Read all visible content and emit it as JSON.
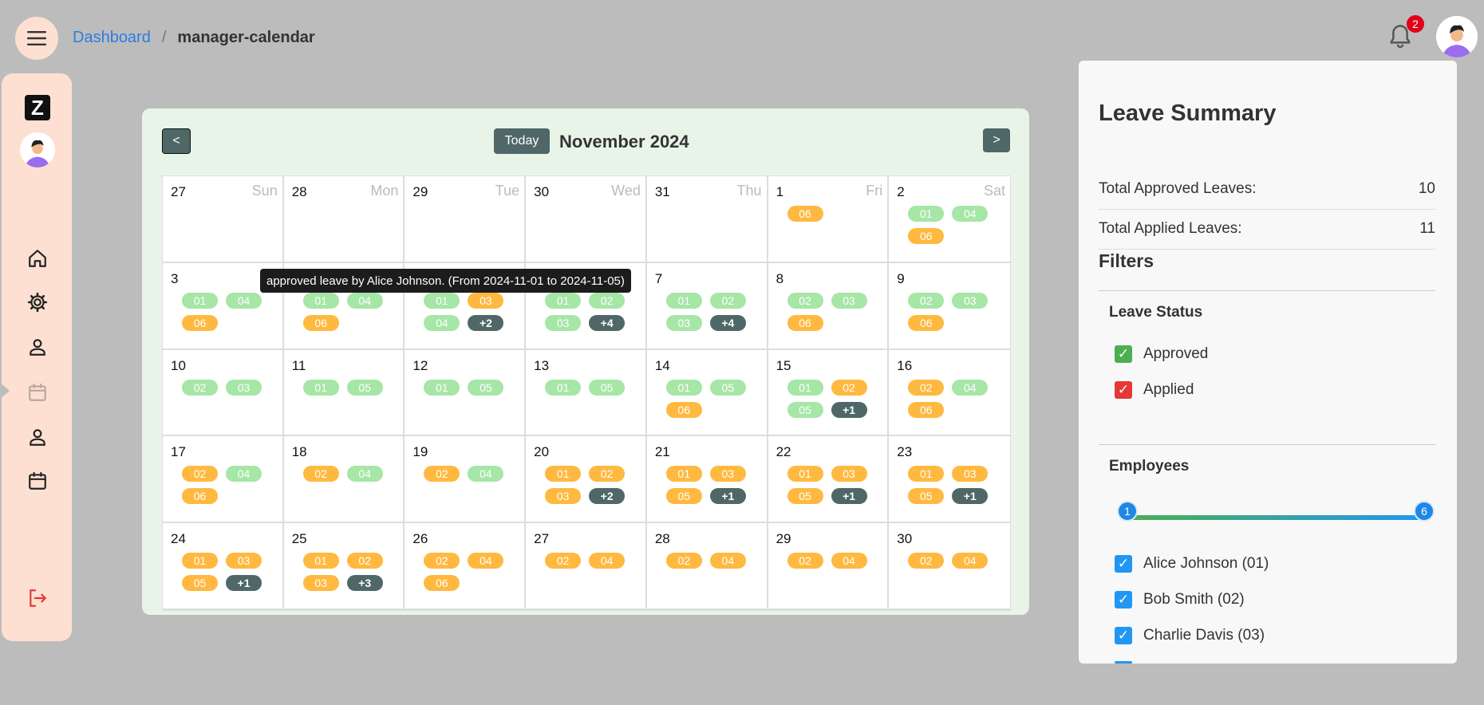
{
  "colors": {
    "approved": "#a6e6a6",
    "applied": "#ffb940",
    "more": "#4f6867",
    "approved_box": "#4caf50",
    "applied_box": "#e53935",
    "employee_box": "#2196f3"
  },
  "header": {
    "menu_icon": "hamburger-icon",
    "breadcrumb": {
      "root": "Dashboard",
      "separator": "/",
      "current": "manager-calendar"
    },
    "notifications": {
      "icon": "bell-icon",
      "count": "2"
    },
    "avatar_icon": "user-avatar"
  },
  "sidebar": {
    "logo": "Z",
    "items": [
      {
        "icon": "home-icon"
      },
      {
        "icon": "gear-icon"
      },
      {
        "icon": "person-icon"
      },
      {
        "icon": "calendar-icon",
        "active": true
      },
      {
        "icon": "person-icon"
      },
      {
        "icon": "calendar-icon"
      }
    ],
    "logout_icon": "logout-icon"
  },
  "calendar": {
    "prev_label": "<",
    "next_label": ">",
    "today_label": "Today",
    "month": "November 2024",
    "tooltip": "approved leave by Alice Johnson. (From 2024-11-01 to 2024-11-05)",
    "weeks": [
      [
        {
          "d": "27",
          "name": "Sun",
          "chips": []
        },
        {
          "d": "28",
          "name": "Mon",
          "chips": []
        },
        {
          "d": "29",
          "name": "Tue",
          "chips": []
        },
        {
          "d": "30",
          "name": "Wed",
          "chips": []
        },
        {
          "d": "31",
          "name": "Thu",
          "chips": []
        },
        {
          "d": "1",
          "name": "Fri",
          "chips": [
            [
              "06",
              "applied"
            ]
          ]
        },
        {
          "d": "2",
          "name": "Sat",
          "chips": [
            [
              "01",
              "approved"
            ],
            [
              "04",
              "approved"
            ],
            [
              "06",
              "applied"
            ]
          ]
        }
      ],
      [
        {
          "d": "3",
          "chips": [
            [
              "01",
              "approved"
            ],
            [
              "04",
              "approved"
            ],
            [
              "06",
              "applied"
            ]
          ]
        },
        {
          "d": "4",
          "chips": [
            [
              "01",
              "approved"
            ],
            [
              "04",
              "approved"
            ],
            [
              "06",
              "applied"
            ]
          ]
        },
        {
          "d": "5",
          "chips": [
            [
              "01",
              "approved"
            ],
            [
              "03",
              "applied"
            ],
            [
              "04",
              "approved"
            ],
            [
              "+2",
              "more"
            ]
          ]
        },
        {
          "d": "6",
          "chips": [
            [
              "01",
              "approved"
            ],
            [
              "02",
              "approved"
            ],
            [
              "03",
              "approved"
            ],
            [
              "+4",
              "more"
            ]
          ]
        },
        {
          "d": "7",
          "chips": [
            [
              "01",
              "approved"
            ],
            [
              "02",
              "approved"
            ],
            [
              "03",
              "approved"
            ],
            [
              "+4",
              "more"
            ]
          ]
        },
        {
          "d": "8",
          "chips": [
            [
              "02",
              "approved"
            ],
            [
              "03",
              "approved"
            ],
            [
              "06",
              "applied"
            ]
          ]
        },
        {
          "d": "9",
          "chips": [
            [
              "02",
              "approved"
            ],
            [
              "03",
              "approved"
            ],
            [
              "06",
              "applied"
            ]
          ]
        }
      ],
      [
        {
          "d": "10",
          "chips": [
            [
              "02",
              "approved"
            ],
            [
              "03",
              "approved"
            ]
          ]
        },
        {
          "d": "11",
          "chips": [
            [
              "01",
              "approved"
            ],
            [
              "05",
              "approved"
            ]
          ]
        },
        {
          "d": "12",
          "chips": [
            [
              "01",
              "approved"
            ],
            [
              "05",
              "approved"
            ]
          ]
        },
        {
          "d": "13",
          "chips": [
            [
              "01",
              "approved"
            ],
            [
              "05",
              "approved"
            ]
          ]
        },
        {
          "d": "14",
          "chips": [
            [
              "01",
              "approved"
            ],
            [
              "05",
              "approved"
            ],
            [
              "06",
              "applied"
            ]
          ]
        },
        {
          "d": "15",
          "chips": [
            [
              "01",
              "approved"
            ],
            [
              "02",
              "applied"
            ],
            [
              "05",
              "approved"
            ],
            [
              "+1",
              "more"
            ]
          ]
        },
        {
          "d": "16",
          "chips": [
            [
              "02",
              "applied"
            ],
            [
              "04",
              "approved"
            ],
            [
              "06",
              "applied"
            ]
          ]
        }
      ],
      [
        {
          "d": "17",
          "chips": [
            [
              "02",
              "applied"
            ],
            [
              "04",
              "approved"
            ],
            [
              "06",
              "applied"
            ]
          ]
        },
        {
          "d": "18",
          "chips": [
            [
              "02",
              "applied"
            ],
            [
              "04",
              "approved"
            ]
          ]
        },
        {
          "d": "19",
          "chips": [
            [
              "02",
              "applied"
            ],
            [
              "04",
              "approved"
            ]
          ]
        },
        {
          "d": "20",
          "chips": [
            [
              "01",
              "applied"
            ],
            [
              "02",
              "applied"
            ],
            [
              "03",
              "applied"
            ],
            [
              "+2",
              "more"
            ]
          ]
        },
        {
          "d": "21",
          "chips": [
            [
              "01",
              "applied"
            ],
            [
              "03",
              "applied"
            ],
            [
              "05",
              "applied"
            ],
            [
              "+1",
              "more"
            ]
          ]
        },
        {
          "d": "22",
          "chips": [
            [
              "01",
              "applied"
            ],
            [
              "03",
              "applied"
            ],
            [
              "05",
              "applied"
            ],
            [
              "+1",
              "more"
            ]
          ]
        },
        {
          "d": "23",
          "chips": [
            [
              "01",
              "applied"
            ],
            [
              "03",
              "applied"
            ],
            [
              "05",
              "applied"
            ],
            [
              "+1",
              "more"
            ]
          ]
        }
      ],
      [
        {
          "d": "24",
          "chips": [
            [
              "01",
              "applied"
            ],
            [
              "03",
              "applied"
            ],
            [
              "05",
              "applied"
            ],
            [
              "+1",
              "more"
            ]
          ]
        },
        {
          "d": "25",
          "chips": [
            [
              "01",
              "applied"
            ],
            [
              "02",
              "applied"
            ],
            [
              "03",
              "applied"
            ],
            [
              "+3",
              "more"
            ]
          ]
        },
        {
          "d": "26",
          "chips": [
            [
              "02",
              "applied"
            ],
            [
              "04",
              "applied"
            ],
            [
              "06",
              "applied"
            ]
          ]
        },
        {
          "d": "27",
          "chips": [
            [
              "02",
              "applied"
            ],
            [
              "04",
              "applied"
            ]
          ]
        },
        {
          "d": "28",
          "chips": [
            [
              "02",
              "applied"
            ],
            [
              "04",
              "applied"
            ]
          ]
        },
        {
          "d": "29",
          "chips": [
            [
              "02",
              "applied"
            ],
            [
              "04",
              "applied"
            ]
          ]
        },
        {
          "d": "30",
          "chips": [
            [
              "02",
              "applied"
            ],
            [
              "04",
              "applied"
            ]
          ]
        }
      ]
    ]
  },
  "summary": {
    "title": "Leave Summary",
    "approved_label": "Total Approved Leaves:",
    "approved_value": "10",
    "applied_label": "Total Applied Leaves:",
    "applied_value": "11",
    "filters_title": "Filters",
    "status_title": "Leave Status",
    "status_options": [
      {
        "label": "Approved",
        "checked": true
      },
      {
        "label": "Applied",
        "checked": true
      }
    ],
    "employees_title": "Employees",
    "range": {
      "min": "1",
      "max": "6"
    },
    "employees": [
      {
        "label": "Alice Johnson (01)",
        "checked": true
      },
      {
        "label": "Bob Smith (02)",
        "checked": true
      },
      {
        "label": "Charlie Davis (03)",
        "checked": true
      }
    ]
  }
}
